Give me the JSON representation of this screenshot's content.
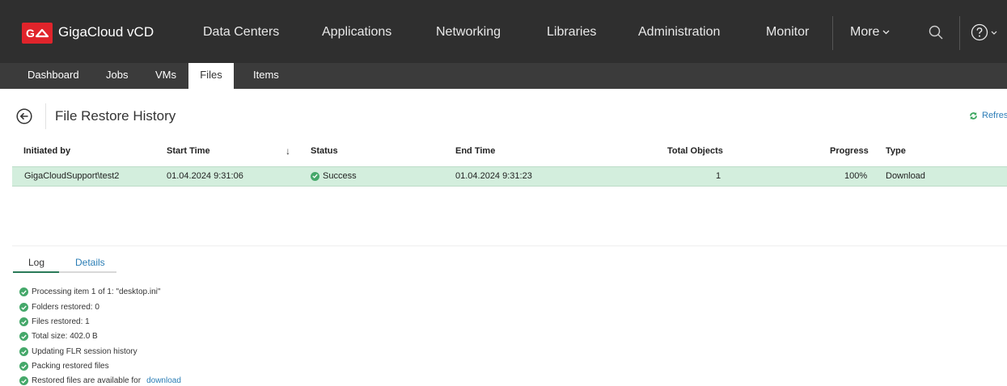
{
  "app": {
    "logo_text": "GO",
    "title": "GigaCloud vCD",
    "brand_color": "#e0242b"
  },
  "mainnav": {
    "items": [
      "Data Centers",
      "Applications",
      "Networking",
      "Libraries",
      "Administration",
      "Monitor"
    ],
    "more_label": "More",
    "search_icon": "search-icon",
    "help_icon": "help-icon"
  },
  "subnav": {
    "tabs": [
      "Dashboard",
      "Jobs",
      "VMs",
      "Files",
      "Items"
    ],
    "active": "Files"
  },
  "page": {
    "title": "File Restore History",
    "refresh_label": "Refresh"
  },
  "table": {
    "columns": [
      "Initiated by",
      "Start Time",
      "Status",
      "End Time",
      "Total Objects",
      "Progress",
      "Type"
    ],
    "sort_indicator": "↓",
    "rows": [
      {
        "initiated_by": "GigaCloudSupport\\test2",
        "start_time": "01.04.2024 9:31:06",
        "status": "Success",
        "end_time": "01.04.2024 9:31:23",
        "total_objects": "1",
        "progress": "100%",
        "type": "Download"
      }
    ]
  },
  "details": {
    "tabs": [
      "Log",
      "Details"
    ],
    "active_tab": "Log",
    "log": [
      "Processing item 1 of 1: \"desktop.ini\"",
      "Folders restored: 0",
      "Files restored: 1",
      "Total size: 402.0 B",
      "Updating FLR session history",
      "Packing restored files",
      "Restored files are available for"
    ],
    "download_link": "download"
  },
  "colors": {
    "success": "#45a86a",
    "selected_row": "#d3eedd",
    "link": "#2a7db5",
    "topbar": "#2f2f2f"
  }
}
